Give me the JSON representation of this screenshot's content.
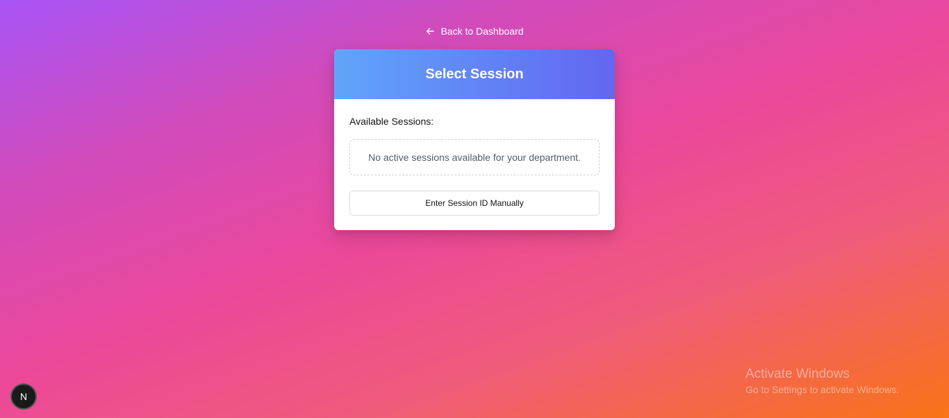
{
  "nav": {
    "back_label": "Back to Dashboard"
  },
  "card": {
    "title": "Select Session",
    "sessions_label": "Available Sessions:",
    "empty_message": "No active sessions available for your department.",
    "manual_button_label": "Enter Session ID Manually"
  },
  "badge": {
    "letter": "N"
  },
  "watermark": {
    "title": "Activate Windows",
    "subtitle": "Go to Settings to activate Windows."
  },
  "colors": {
    "header_gradient_start": "#60a5fa",
    "header_gradient_end": "#6366f1",
    "background_top_left": "#a855f7",
    "background_center": "#ec4899",
    "background_bottom_right": "#f97316"
  },
  "icons": {
    "back": "arrow-left-icon"
  }
}
